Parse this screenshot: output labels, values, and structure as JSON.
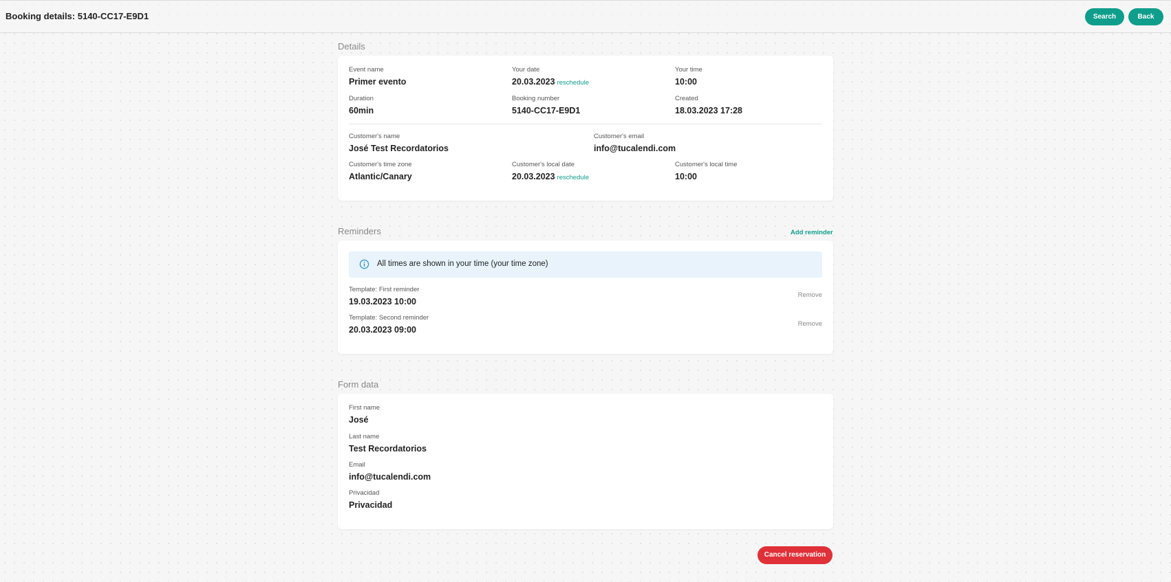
{
  "header": {
    "title": "Booking details: 5140-CC17-E9D1",
    "search_label": "Search",
    "back_label": "Back"
  },
  "details": {
    "section_title": "Details",
    "event_name": {
      "label": "Event name",
      "value": "Primer evento"
    },
    "your_date": {
      "label": "Your date",
      "value": "20.03.2023",
      "action": "reschedule"
    },
    "your_time": {
      "label": "Your time",
      "value": "10:00"
    },
    "duration": {
      "label": "Duration",
      "value": "60min"
    },
    "booking_number": {
      "label": "Booking number",
      "value": "5140-CC17-E9D1"
    },
    "created": {
      "label": "Created",
      "value": "18.03.2023 17:28"
    },
    "customer_name": {
      "label": "Customer's name",
      "value": "José Test Recordatorios"
    },
    "customer_email": {
      "label": "Customer's email",
      "value": "info@tucalendi.com"
    },
    "customer_time_zone": {
      "label": "Customer's time zone",
      "value": "Atlantic/Canary"
    },
    "customer_local_date": {
      "label": "Customer's local date",
      "value": "20.03.2023",
      "action": "reschedule"
    },
    "customer_local_time": {
      "label": "Customer's local time",
      "value": "10:00"
    }
  },
  "reminders": {
    "section_title": "Reminders",
    "add_label": "Add reminder",
    "info_text": "All times are shown in your time (your time zone)",
    "items": [
      {
        "label": "Template: First reminder",
        "value": "19.03.2023 10:00",
        "remove_label": "Remove"
      },
      {
        "label": "Template: Second reminder",
        "value": "20.03.2023 09:00",
        "remove_label": "Remove"
      }
    ]
  },
  "form_data": {
    "section_title": "Form data",
    "fields": [
      {
        "label": "First name",
        "value": "José"
      },
      {
        "label": "Last name",
        "value": "Test Recordatorios"
      },
      {
        "label": "Email",
        "value": "info@tucalendi.com"
      },
      {
        "label": "Privacidad",
        "value": "Privacidad"
      }
    ]
  },
  "cancel_label": "Cancel reservation",
  "colors": {
    "accent": "#0f9e8c",
    "danger": "#e03038",
    "info_bg": "#e8f3fb",
    "info_icon": "#2a8fd6"
  }
}
